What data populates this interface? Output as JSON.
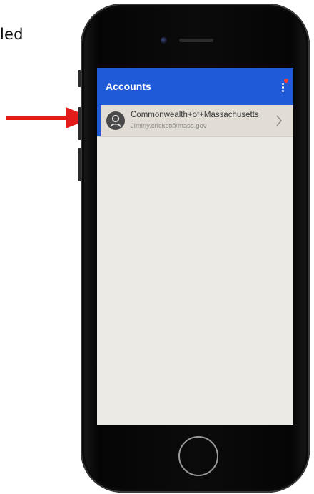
{
  "document": {
    "fragment_text": "led"
  },
  "annotation": {
    "arrow_color": "#e31b1b"
  },
  "app": {
    "title": "Accounts",
    "bar_color": "#1f5bd8",
    "menu_icon": "more-vertical-icon",
    "notification_badge_color": "#ff3b30"
  },
  "accounts": [
    {
      "name": "Commonwealth+of+Massachusetts",
      "email": "Jiminy.cricket@mass.gov",
      "avatar_icon": "person-icon",
      "chevron_icon": "chevron-right-icon"
    }
  ]
}
